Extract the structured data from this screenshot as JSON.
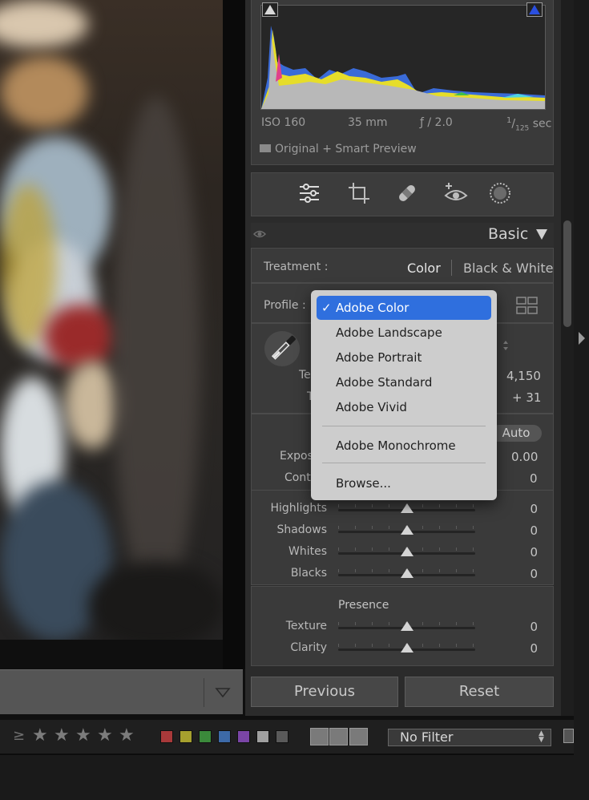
{
  "histogram": {
    "exif": {
      "iso": "ISO 160",
      "focal": "35 mm",
      "aperture": "ƒ / 2.0",
      "shutter_num": "1",
      "shutter_den": "125",
      "shutter_unit": "sec"
    },
    "preview_status": "Original + Smart Preview"
  },
  "tools": [
    "edit-sliders-icon",
    "crop-icon",
    "healing-icon",
    "red-eye-icon",
    "masking-icon"
  ],
  "basic": {
    "title": "Basic",
    "treatment_label": "Treatment :",
    "treatment_color": "Color",
    "treatment_bw": "Black & White",
    "profile_label": "Profile :",
    "temp_label_partial": "Te",
    "tint_label_partial": "T",
    "temp_value": "4,150",
    "tint_value": "+ 31",
    "auto_label": "Auto",
    "exposure_label_partial": "Expos",
    "exposure_value": "0.00",
    "contrast_label_partial": "Contr",
    "contrast_value": "0",
    "tone_sliders": [
      {
        "label": "Highlights",
        "value": "0",
        "position": 0.5
      },
      {
        "label": "Shadows",
        "value": "0",
        "position": 0.5
      },
      {
        "label": "Whites",
        "value": "0",
        "position": 0.5
      },
      {
        "label": "Blacks",
        "value": "0",
        "position": 0.5
      }
    ],
    "presence_title": "Presence",
    "presence_sliders": [
      {
        "label": "Texture",
        "value": "0",
        "position": 0.5
      },
      {
        "label": "Clarity",
        "value": "0",
        "position": 0.5
      }
    ]
  },
  "buttons": {
    "previous": "Previous",
    "reset": "Reset"
  },
  "profile_menu": {
    "items": [
      "Adobe Color",
      "Adobe Landscape",
      "Adobe Portrait",
      "Adobe Standard",
      "Adobe Vivid"
    ],
    "selected": "Adobe Color",
    "check": "✓",
    "monochrome": "Adobe Monochrome",
    "browse": "Browse..."
  },
  "filter_bar": {
    "ge_symbol": "≥",
    "stars": [
      "★",
      "★",
      "★",
      "★",
      "★"
    ],
    "color_labels": [
      "#a8393a",
      "#a6a02e",
      "#3b8a3b",
      "#3d6aa8",
      "#7a45a6",
      "#a0a0a0",
      "#5a5a5a"
    ],
    "filter_value": "No Filter"
  },
  "colors": {
    "accent": "#2f6fde",
    "panel": "#3a3a3a",
    "menu": "#cdcdcd"
  }
}
